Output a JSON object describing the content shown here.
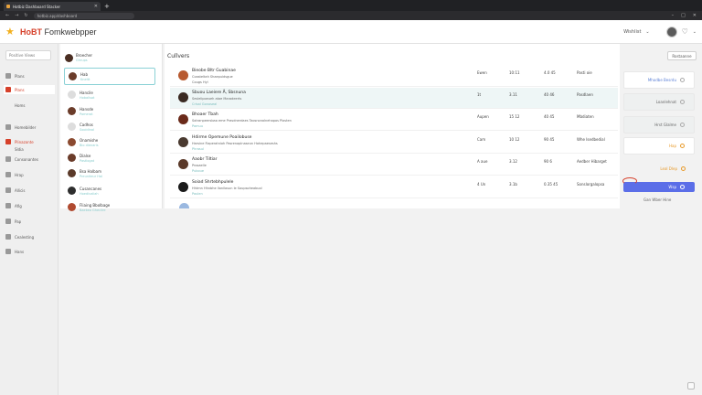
{
  "browser": {
    "tab_title": "Hotbiz Dashboard Stacker",
    "url": "hotbiz.app/dashboard"
  },
  "header": {
    "brand_a": "HoBT",
    "brand_b": " Fomkwebpper",
    "menu_label": "Wishlist"
  },
  "sidebar": {
    "search": "Positive Views",
    "items": [
      {
        "label": "Plans"
      },
      {
        "label": "Plans"
      },
      {
        "label": "Homs"
      },
      {
        "label": "Homebilder"
      },
      {
        "label": "Plinazonte"
      },
      {
        "label": "Sldia"
      },
      {
        "label": "Consonantes"
      },
      {
        "label": "Hrap"
      },
      {
        "label": "Allicis"
      },
      {
        "label": "Afig"
      },
      {
        "label": "Pap"
      },
      {
        "label": "Cealesting"
      },
      {
        "label": "Hans"
      }
    ]
  },
  "list": {
    "top_name": "Broecher",
    "top_sub": "Ghrups",
    "items": [
      {
        "name": "Hab",
        "sub": "Kneitt",
        "selected": true
      },
      {
        "name": "Hancile",
        "sub": "Hobalisat"
      },
      {
        "name": "Hansde",
        "sub": "Pomerat"
      },
      {
        "name": "Cadhos",
        "sub": "Sooidinal"
      },
      {
        "name": "Onamishe",
        "sub": "Bio dienaris"
      },
      {
        "name": "Dialse",
        "sub": "Pastlogat"
      },
      {
        "name": "Bsa Halbam",
        "sub": "Preuniteur Hal"
      },
      {
        "name": "Cusancanes",
        "sub": "Hoedivaliah"
      },
      {
        "name": "Fliaing Bbolbage",
        "sub": "Baekeo Gheclire"
      }
    ]
  },
  "main": {
    "title": "Cullvers",
    "rows": [
      {
        "title": "Bieobe Bltr Guabinae",
        "sub": "Coasteltah Shaepuidsgue",
        "sub2": "Cougs Hyl",
        "c1": "Ewen",
        "c2": "10:11",
        "c3": "4.0 45",
        "c4": "Pasti oie"
      },
      {
        "title": "Sbuou Laeiere Å, Sbsnuna",
        "sub": "Seslelipoeueh atae Maradeerts",
        "sub2": "Crisal Gonoseal",
        "c1": "1t",
        "c2": "3.11",
        "c3": "40 46",
        "c4": "Pasdlaen",
        "highlight": true
      },
      {
        "title": "Bhoaer Tbah",
        "sub": "Sotranpeersbaa eme Prasdnerdaes Taosnonalnehapos Plosten",
        "sub2": "Pamuu",
        "c1": "Aupen",
        "c2": "15 12",
        "c3": "40 45",
        "c4": "Mbdiaten"
      },
      {
        "title": "Hdirme Opemune Poailobuse",
        "sub": "Harsine Fiaperatnioh Pasrenaplnaseun Hohepaeseshs",
        "sub2": "Phrasul",
        "c1": "Cam",
        "c2": "10 12",
        "c3": "90 45",
        "c4": "Whe Isedbedial"
      },
      {
        "title": "Aaobr Tiltiar",
        "sub": "Prosaelle",
        "sub2": "Puboue",
        "c1": "A aue",
        "c2": "3.12",
        "c3": "90 6",
        "c4": "Aedber Hibarget"
      },
      {
        "title": "Soiad Shrtebhpulele",
        "sub": "Hhtmn Hhnbhe Ilonilasun le Soupsoheabuol",
        "sub2": "Paulen",
        "c1": "4 Un",
        "c2": "3.1b",
        "c3": "0.35 45",
        "c4": "Sonslorgalopsa"
      }
    ]
  },
  "right": {
    "button": "Rostaanne",
    "cards": [
      {
        "label": "Mhodbe Besrdu",
        "style": "blue"
      },
      {
        "label": "Loanlehnat",
        "style": "gray"
      },
      {
        "label": "Hrst Glalme",
        "style": "gray"
      },
      {
        "label": "Hap",
        "style": "orange"
      },
      {
        "label": "Leal Dlep",
        "style": "orange"
      },
      {
        "label": "Wsp",
        "style": "primary"
      }
    ],
    "footer": "Gan Wber Hine"
  }
}
